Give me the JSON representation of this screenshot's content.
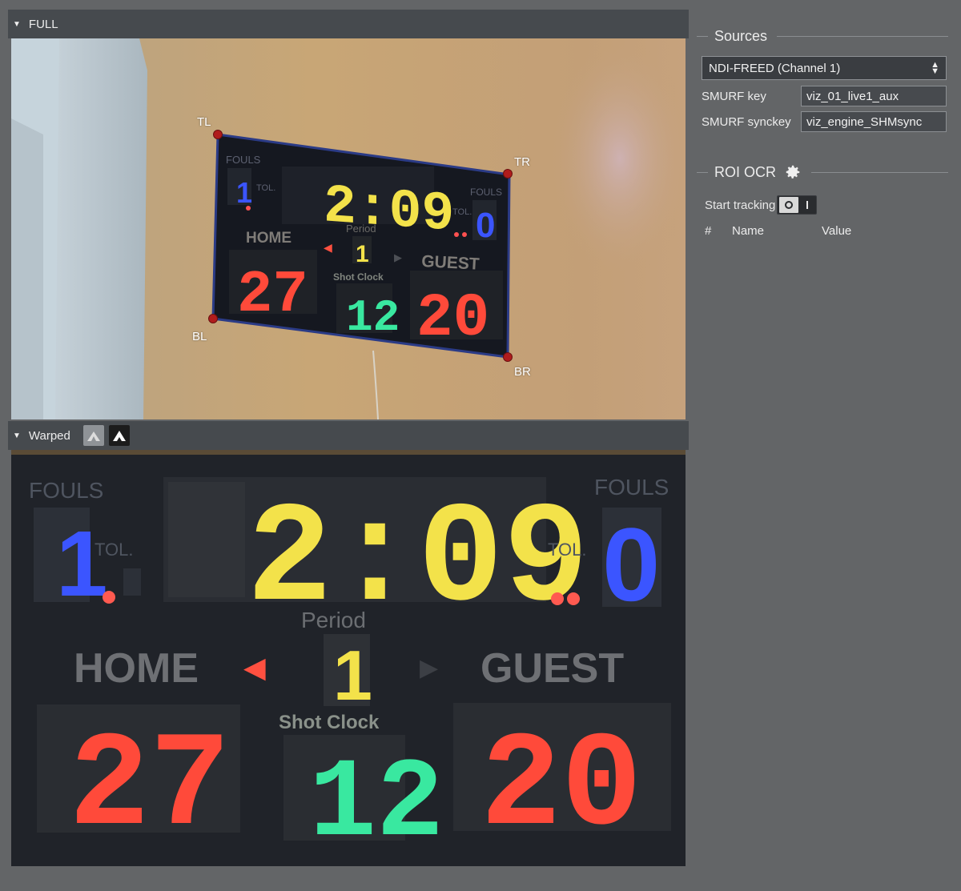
{
  "full_panel": {
    "title": "FULL",
    "corners": {
      "tl": "TL",
      "tr": "TR",
      "bl": "BL",
      "br": "BR"
    }
  },
  "warped_panel": {
    "title": "Warped"
  },
  "scoreboard": {
    "fouls_label": "FOULS",
    "tol_label": "TOL.",
    "home_fouls": "1",
    "guest_fouls": "0",
    "clock": "2:09",
    "period_label": "Period",
    "period": "1",
    "home_label": "HOME",
    "guest_label": "GUEST",
    "home_score": "27",
    "guest_score": "20",
    "shot_clock_label": "Shot Clock",
    "shot_clock": "12"
  },
  "sources": {
    "title": "Sources",
    "selected_source": "NDI-FREED (Channel 1)",
    "smurf_key_label": "SMURF key",
    "smurf_key_value": "viz_01_live1_aux",
    "smurf_synckey_label": "SMURF synckey",
    "smurf_synckey_value": "viz_engine_SHMsync"
  },
  "roi_ocr": {
    "title": "ROI OCR",
    "start_tracking_label": "Start tracking",
    "columns": [
      "#",
      "Name",
      "Value"
    ]
  },
  "colors": {
    "yellow_led": "#f3e24a",
    "red_led": "#ff4a3a",
    "blue_led": "#3b55ff",
    "green_led": "#39e8a0"
  }
}
